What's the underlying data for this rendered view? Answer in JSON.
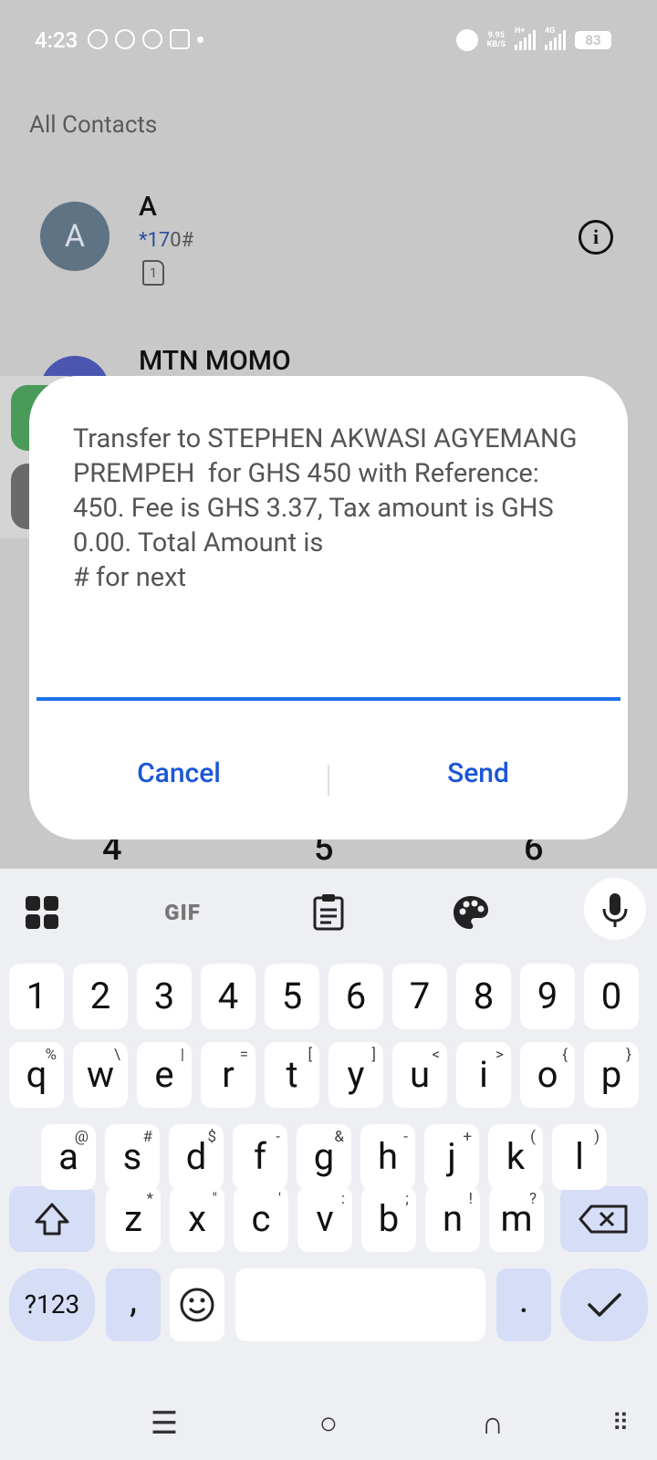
{
  "status_bar": {
    "time": "4:23",
    "net_speed_value": "9.95",
    "net_speed_unit": "KB/S",
    "net1_label": "H+",
    "net2_label": "4G",
    "battery": "83"
  },
  "contacts": {
    "section_title": "All Contacts",
    "items": [
      {
        "initial": "A",
        "name": "A",
        "number_highlight": "*17",
        "number_rest": "0#",
        "sim": "1"
      },
      {
        "name": "MTN MOMO"
      }
    ]
  },
  "dialpad_peek": [
    "4",
    "5",
    "6"
  ],
  "dialog": {
    "message": "Transfer to STEPHEN AKWASI AGYEMANG PREMPEH  for GHS 450 with Reference: 450. Fee is GHS 3.37, Tax amount is GHS 0.00. Total Amount is\n# for next",
    "input_value": "",
    "cancel_label": "Cancel",
    "send_label": "Send"
  },
  "keyboard": {
    "toolbar": {
      "apps_icon": "apps-icon",
      "gif_label": "GIF",
      "clipboard_icon": "clipboard-icon",
      "palette_icon": "palette-icon",
      "mic_icon": "mic-icon"
    },
    "row_numbers": [
      "1",
      "2",
      "3",
      "4",
      "5",
      "6",
      "7",
      "8",
      "9",
      "0"
    ],
    "row1": [
      {
        "k": "q",
        "h": "%"
      },
      {
        "k": "w",
        "h": "\\"
      },
      {
        "k": "e",
        "h": "|"
      },
      {
        "k": "r",
        "h": "="
      },
      {
        "k": "t",
        "h": "["
      },
      {
        "k": "y",
        "h": "]"
      },
      {
        "k": "u",
        "h": "<"
      },
      {
        "k": "i",
        "h": ">"
      },
      {
        "k": "o",
        "h": "{"
      },
      {
        "k": "p",
        "h": "}"
      }
    ],
    "row2": [
      {
        "k": "a",
        "h": "@"
      },
      {
        "k": "s",
        "h": "#"
      },
      {
        "k": "d",
        "h": "$"
      },
      {
        "k": "f",
        "h": "-"
      },
      {
        "k": "g",
        "h": "&"
      },
      {
        "k": "h",
        "h": "-"
      },
      {
        "k": "j",
        "h": "+"
      },
      {
        "k": "k",
        "h": "("
      },
      {
        "k": "l",
        "h": ")"
      }
    ],
    "row3": [
      {
        "k": "z",
        "h": "*"
      },
      {
        "k": "x",
        "h": "\""
      },
      {
        "k": "c",
        "h": "'"
      },
      {
        "k": "v",
        "h": ":"
      },
      {
        "k": "b",
        "h": ";"
      },
      {
        "k": "n",
        "h": "!"
      },
      {
        "k": "m",
        "h": "?"
      }
    ],
    "symbols_label": "?123",
    "comma_label": ",",
    "period_label": "."
  },
  "colors": {
    "accent": "#1a57d6",
    "input_line": "#1a73e8",
    "avatar": "#5e7384",
    "special_key": "#d6ddf6"
  }
}
